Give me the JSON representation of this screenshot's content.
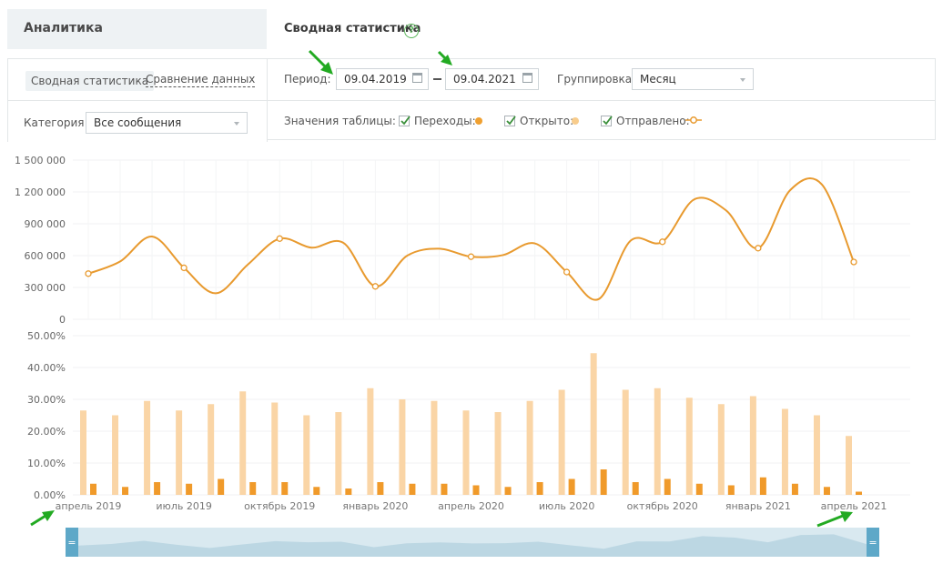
{
  "sidebar": {
    "title": "Аналитика"
  },
  "header": {
    "title": "Сводная статистика",
    "help_glyph": "?"
  },
  "tabs": [
    {
      "label": "Сводная статистика",
      "active": true
    },
    {
      "label": "Сравнение данных",
      "active": false
    }
  ],
  "filters": {
    "category_label": "Категория",
    "category_value": "Все сообщения",
    "period_label": "Период:",
    "date_from": "09.04.2019",
    "date_to": "09.04.2021",
    "grouping_label": "Группировка",
    "grouping_value": "Месяц"
  },
  "table_values": {
    "label": "Значения таблицы:",
    "items": [
      {
        "label": "Переходы:",
        "checked": true,
        "color": "#f0a030",
        "icon": "filled-dot-icon"
      },
      {
        "label": "Открыто:",
        "checked": true,
        "color": "#f8cc8c",
        "icon": "filled-dot-icon"
      },
      {
        "label": "Отправлено:",
        "checked": true,
        "color": "#e89a2f",
        "icon": "line-marker-icon"
      }
    ]
  },
  "colors": {
    "accent": "#e89a2f",
    "light": "#fad5a6",
    "dark": "#f09a2a",
    "navigator": "#d6e7ef",
    "handle": "#5ea8c8",
    "arrows": "#22aa22"
  },
  "chart_data": [
    {
      "type": "line",
      "series": [
        {
          "values": [
            430000,
            545000,
            780000,
            485000,
            245000,
            515000,
            760000,
            675000,
            720000,
            310000,
            600000,
            665000,
            590000,
            605000,
            715000,
            445000,
            190000,
            740000,
            730000,
            1130000,
            1025000,
            670000,
            1215000,
            1270000,
            540000
          ]
        }
      ],
      "ylim": [
        0,
        1500000
      ],
      "yticks": [
        "1 500 000",
        "1 200 000",
        "900 000",
        "600 000",
        "300 000",
        "0"
      ]
    },
    {
      "type": "bar",
      "series": [
        {
          "color": "#fad5a6",
          "values": [
            26.5,
            25,
            29.5,
            26.5,
            28.5,
            32.5,
            29,
            25,
            26,
            33.5,
            30,
            29.5,
            26.5,
            26,
            29.5,
            33,
            44.5,
            33,
            33.5,
            30.5,
            28.5,
            31,
            27,
            25,
            18.5
          ]
        },
        {
          "color": "#f09a2a",
          "values": [
            3.5,
            2.5,
            4,
            3.5,
            5,
            4,
            4,
            2.5,
            2,
            4,
            3.5,
            3.5,
            3,
            2.5,
            4,
            5,
            8,
            4,
            5,
            3.5,
            3,
            5.5,
            3.5,
            2.5,
            1
          ]
        }
      ],
      "ylim": [
        0,
        50
      ],
      "yticks": [
        "50.00%",
        "40.00%",
        "30.00%",
        "20.00%",
        "10.00%",
        "0.00%"
      ],
      "x_labels": [
        "апрель 2019",
        "июль 2019",
        "октябрь 2019",
        "январь 2020",
        "апрель 2020",
        "июль 2020",
        "октябрь 2020",
        "январь 2021",
        "апрель 2021"
      ]
    }
  ],
  "navigator": {
    "handle_glyph": "="
  }
}
